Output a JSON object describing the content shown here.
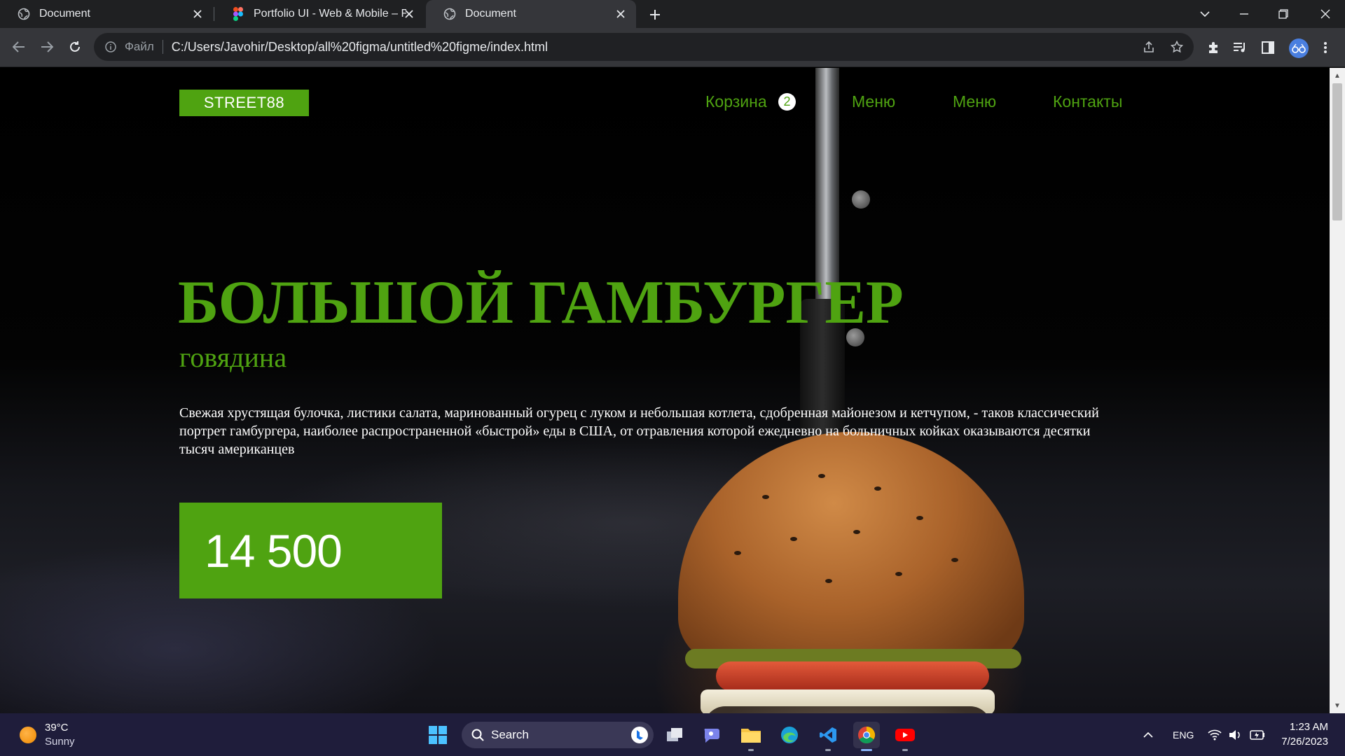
{
  "browser": {
    "tabs": [
      {
        "title": "Document",
        "icon": "globe-icon"
      },
      {
        "title": "Portfolio UI - Web & Mobile – Fig",
        "icon": "figma-icon"
      },
      {
        "title": "Document",
        "icon": "globe-icon"
      }
    ],
    "address": {
      "scheme_label": "Файл",
      "url": "C:/Users/Javohir/Desktop/all%20figma/untitled%20figme/index.html"
    }
  },
  "site": {
    "logo": "STREET88",
    "nav": {
      "cart": "Корзина",
      "cart_count": "2",
      "menu_1": "Меню",
      "menu_2": "Меню",
      "contacts": "Контакты"
    },
    "hero": {
      "title": "БОЛЬШОЙ ГАМБУРГЕР",
      "subtitle": "говядина",
      "description": "Свежая хрустящая булочка, листики салата, маринованный огурец с луком и небольшая котлета, сдобренная майонезом и кетчупом, - таков классический портрет гамбургера, наиболее распространенной «быстрой» еды в США, от отравления которой ежедневно на больничных койках оказываются десятки тысяч американцев",
      "price": "14 500"
    },
    "colors": {
      "accent": "#4fa311",
      "background": "#000000"
    }
  },
  "taskbar": {
    "weather": {
      "temp": "39°C",
      "condition": "Sunny"
    },
    "search_label": "Search",
    "language": "ENG",
    "time": "1:23 AM",
    "date": "7/26/2023"
  }
}
